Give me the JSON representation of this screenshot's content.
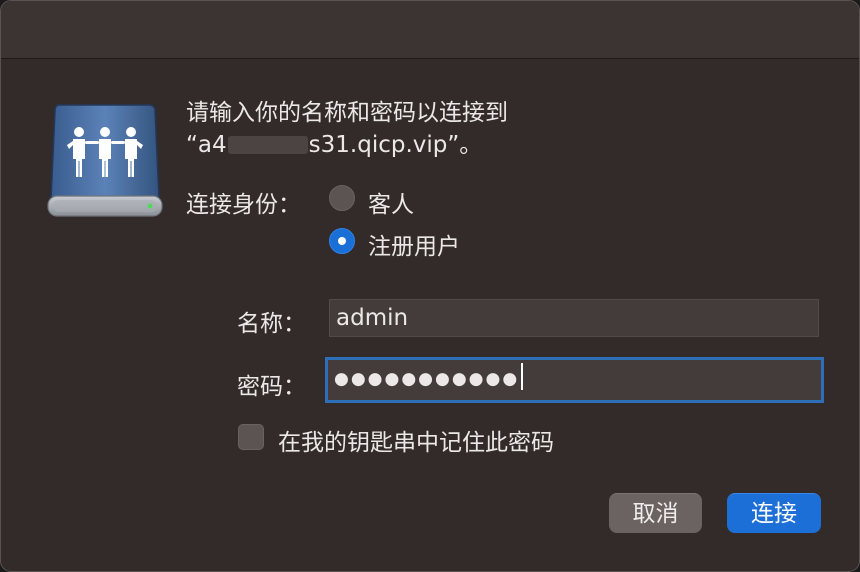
{
  "dialog": {
    "prompt_line1": "请输入你的名称和密码以连接到",
    "prompt_host_prefix": "“a4",
    "prompt_host_suffix": "s31.qicp.vip”。",
    "icon": "network-server-icon"
  },
  "connect_as": {
    "label": "连接身份：",
    "options": [
      {
        "label": "客人",
        "selected": false
      },
      {
        "label": "注册用户",
        "selected": true
      }
    ]
  },
  "form": {
    "name_label": "名称：",
    "name_value": "admin",
    "password_label": "密码：",
    "password_dots": "●●●●●●●●●●●",
    "remember_label": "在我的钥匙串中记住此密码",
    "remember_checked": false
  },
  "buttons": {
    "cancel": "取消",
    "connect": "连接"
  },
  "colors": {
    "accent": "#1d6fd8",
    "window_bg": "#322b2a",
    "focus_ring": "#2c6fb6"
  }
}
